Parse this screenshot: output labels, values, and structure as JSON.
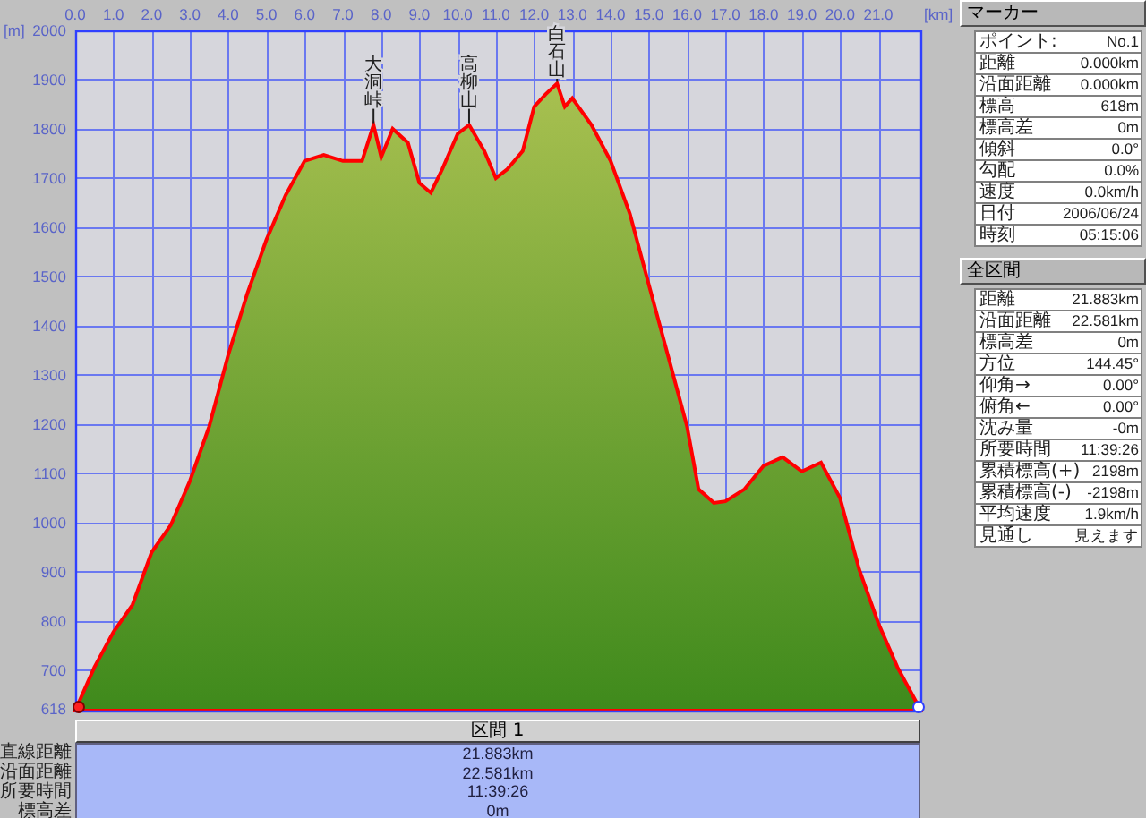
{
  "chart": {
    "chart_data": {
      "type": "area",
      "grid": true,
      "xlabel": "[km]",
      "ylabel": "[m]",
      "xlim": [
        0,
        22.1
      ],
      "ylim": [
        618,
        2000
      ],
      "xticks": [
        {
          "value": 0,
          "label": "0.0"
        },
        {
          "value": 1,
          "label": "1.0"
        },
        {
          "value": 2,
          "label": "2.0"
        },
        {
          "value": 3,
          "label": "3.0"
        },
        {
          "value": 4,
          "label": "4.0"
        },
        {
          "value": 5,
          "label": "5.0"
        },
        {
          "value": 6,
          "label": "6.0"
        },
        {
          "value": 7,
          "label": "7.0"
        },
        {
          "value": 8,
          "label": "8.0"
        },
        {
          "value": 9,
          "label": "9.0"
        },
        {
          "value": 10,
          "label": "10.0"
        },
        {
          "value": 11,
          "label": "11.0"
        },
        {
          "value": 12,
          "label": "12.0"
        },
        {
          "value": 13,
          "label": "13.0"
        },
        {
          "value": 14,
          "label": "14.0"
        },
        {
          "value": 15,
          "label": "15.0"
        },
        {
          "value": 16,
          "label": "16.0"
        },
        {
          "value": 17,
          "label": "17.0"
        },
        {
          "value": 18,
          "label": "18.0"
        },
        {
          "value": 19,
          "label": "19.0"
        },
        {
          "value": 20,
          "label": "20.0"
        },
        {
          "value": 21,
          "label": "21.0"
        }
      ],
      "yticks": [
        618,
        700,
        800,
        900,
        1000,
        1100,
        1200,
        1300,
        1400,
        1500,
        1600,
        1700,
        1800,
        1900,
        2000
      ],
      "x": [
        0,
        0.5,
        1,
        1.5,
        2,
        2.5,
        3,
        3.5,
        4,
        4.5,
        5,
        5.5,
        6,
        6.5,
        7,
        7.5,
        7.8,
        8,
        8.3,
        8.7,
        9,
        9.3,
        9.6,
        10,
        10.3,
        10.7,
        11,
        11.3,
        11.7,
        12,
        12.3,
        12.6,
        12.8,
        13,
        13.5,
        14,
        14.5,
        15,
        15.5,
        16,
        16.3,
        16.7,
        17,
        17.5,
        18,
        18.5,
        19,
        19.5,
        20,
        20.5,
        21,
        21.5,
        22,
        22.1
      ],
      "series": [
        {
          "color": "#ff0000",
          "values": [
            618,
            706,
            778,
            833,
            940,
            995,
            1085,
            1195,
            1340,
            1465,
            1575,
            1665,
            1735,
            1747,
            1735,
            1735,
            1808,
            1743,
            1800,
            1772,
            1690,
            1670,
            1718,
            1790,
            1808,
            1755,
            1700,
            1718,
            1755,
            1845,
            1870,
            1892,
            1845,
            1862,
            1808,
            1735,
            1628,
            1483,
            1340,
            1195,
            1068,
            1040,
            1043,
            1068,
            1115,
            1133,
            1104,
            1122,
            1050,
            905,
            796,
            706,
            634,
            618
          ]
        }
      ],
      "annotations": [
        {
          "x": 7.8,
          "text": "大洞峠"
        },
        {
          "x": 10.3,
          "text": "高柳山"
        },
        {
          "x": 12.6,
          "text": "白石山"
        }
      ]
    }
  },
  "section": {
    "title": "区間 1",
    "rows": [
      {
        "label": "直線距離",
        "value": "21.883km"
      },
      {
        "label": "沿面距離",
        "value": "22.581km"
      },
      {
        "label": "所要時間",
        "value": "11:39:26"
      },
      {
        "label": "標高差",
        "value": "0m"
      }
    ]
  },
  "marker_panel": {
    "title": "マーカー",
    "rows": [
      {
        "label": "ポイント:",
        "value": "No.1"
      },
      {
        "label": "距離",
        "value": "0.000km"
      },
      {
        "label": "沿面距離",
        "value": "0.000km"
      },
      {
        "label": "標高",
        "value": "618m"
      },
      {
        "label": "標高差",
        "value": "0m"
      },
      {
        "label": "傾斜",
        "value": "0.0°"
      },
      {
        "label": "勾配",
        "value": "0.0%"
      },
      {
        "label": "速度",
        "value": "0.0km/h"
      },
      {
        "label": "日付",
        "value": "2006/06/24"
      },
      {
        "label": "時刻",
        "value": "05:15:06"
      }
    ]
  },
  "total_panel": {
    "title": "全区間",
    "rows": [
      {
        "label": "距離",
        "value": "21.883km"
      },
      {
        "label": "沿面距離",
        "value": "22.581km"
      },
      {
        "label": "標高差",
        "value": "0m"
      },
      {
        "label": "方位",
        "value": "144.45°"
      },
      {
        "label": "仰角→",
        "value": "0.00°"
      },
      {
        "label": "俯角←",
        "value": "0.00°"
      },
      {
        "label": "沈み量",
        "value": "-0m"
      },
      {
        "label": "所要時間",
        "value": "11:39:26"
      },
      {
        "label": "累積標高(+)",
        "value": "2198m"
      },
      {
        "label": "累積標高(-)",
        "value": "-2198m"
      },
      {
        "label": "平均速度",
        "value": "1.9km/h"
      },
      {
        "label": "見通し",
        "value": "見えます"
      }
    ]
  }
}
